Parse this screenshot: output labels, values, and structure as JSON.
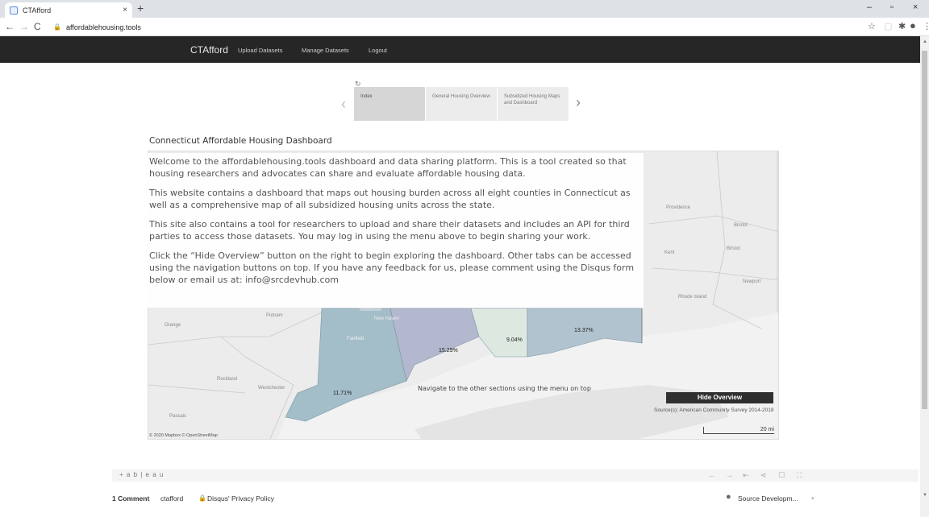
{
  "browser": {
    "tab_title": "CTAfford",
    "tab_close": "×",
    "new_tab": "+",
    "win_min": "–",
    "win_max": "▫",
    "win_close": "×",
    "url": "affordablehousing.tools"
  },
  "sitenav": {
    "brand": "CTAfford",
    "links": [
      "Upload Datasets",
      "Manage Datasets",
      "Logout"
    ]
  },
  "story": {
    "tabs": [
      "Index",
      "General Housing Overview",
      "Subsidized Housing Maps and Dashboard"
    ],
    "active": 0
  },
  "dashboard": {
    "title": "Connecticut Affordable Housing Dashboard",
    "paragraphs": [
      "Welcome to the affordablehousing.tools dashboard and data sharing platform. This is a tool created so that housing researchers and advocates can share and evaluate affordable housing data.",
      "This website contains a dashboard that maps out housing burden across all eight counties in Connecticut as well as a comprehensive map of all subsidized housing units across the state.",
      "This site also contains a tool for researchers to upload and share their datasets and includes an API for third parties to access those datasets. You may log in using the menu above to begin sharing your work.",
      "Click the “Hide Overview” button on the right to begin exploring the dashboard. Other tabs can be accessed using the navigation buttons on top. If you have any feedback for us, please comment using the Disqus form below or email us at: info@srcdevhub.com"
    ],
    "nav_hint": "Navigate to the other sections using the menu on top",
    "hide_button": "Hide Overview",
    "source": "Source(s): American Community Survey 2014-2018",
    "scale": "20 mi",
    "copyright": "© 2020 Mapbox © OpenStreetMap",
    "map_labels": {
      "providence": "Providence",
      "bristol1": "Bristol",
      "bristol2": "Bristol",
      "kent": "Kent",
      "newport": "Newport",
      "rhode_island": "Rhode Island",
      "orange": "Orange",
      "putnam": "Putnam",
      "fairfield": "Fairfield",
      "new_haven": "New Haven",
      "middlesex": "Middlesex",
      "rockland": "Rockland",
      "westchester": "Westchester",
      "passaic": "Passaic"
    },
    "percentages": {
      "fairfield": "11.71%",
      "new_haven": "15.29%",
      "middlesex": "9.04%",
      "new_london": "13.37%"
    },
    "colors": {
      "fairfield": "#a3bdc9",
      "new_haven": "#b3b8cf",
      "middlesex": "#dde8e1",
      "new_london": "#b1c3cf"
    }
  },
  "tableau": {
    "logo": "+ a b | e a u"
  },
  "disqus": {
    "comments": "1 Comment",
    "user": "ctafford",
    "privacy": "Disqus' Privacy Policy",
    "org": "Source Developm..."
  }
}
